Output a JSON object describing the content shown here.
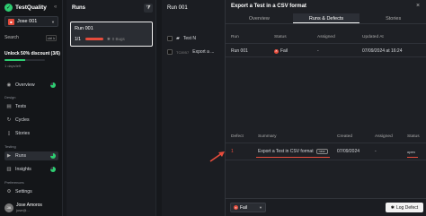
{
  "app": {
    "name": "TestQuality"
  },
  "sidebar": {
    "project": "Jose 001",
    "search_label": "Search",
    "search_shortcut": "ctrl k",
    "unlock": {
      "label": "Unlock 50% discount (3/6)",
      "progress": 0.5,
      "sub": "1 days/left"
    },
    "sections": {
      "design": "Design",
      "testing": "Testing",
      "preferences": "Preferences"
    },
    "items": [
      {
        "label": "Overview"
      },
      {
        "label": "Tests"
      },
      {
        "label": "Cycles"
      },
      {
        "label": "Stories"
      },
      {
        "label": "Runs"
      },
      {
        "label": "Insights"
      },
      {
        "label": "Settings"
      },
      {
        "label": "Integrations"
      }
    ],
    "user": {
      "initials": "JA",
      "name": "Jose Amoros",
      "email": "jose@..."
    }
  },
  "runs": {
    "title": "Runs",
    "card": {
      "name": "Run 001",
      "count": "1/1",
      "bugs": "0 Bugs"
    }
  },
  "run_detail": {
    "title": "Run 001",
    "rows": [
      {
        "label": "Test N"
      },
      {
        "id": "TC8957",
        "label": "Export a ..."
      }
    ]
  },
  "drawer": {
    "title": "Export a Test in a CSV format",
    "close": "×",
    "tabs": [
      "Overview",
      "Runs & Defects",
      "Stories"
    ],
    "runs_table": {
      "headers": [
        "Run",
        "Status",
        "Assigned",
        "Updated At"
      ],
      "rows": [
        {
          "run": "Run 001",
          "status": "Fail",
          "assigned": "-",
          "updated": "07/09/2024 at 16:24"
        }
      ]
    },
    "defects_table": {
      "headers": [
        "Defect",
        "Summary",
        "Created",
        "Assigned",
        "Status"
      ],
      "rows": [
        {
          "defect": "1",
          "summary": "Export a Test in CSV format",
          "badge": "new",
          "created": "07/09/2024",
          "assigned": "-",
          "status": "open"
        }
      ]
    },
    "footer": {
      "status": "Fail",
      "log_button": "Log Defect"
    }
  },
  "colors": {
    "accent": "#2ecc71",
    "fail": "#e74c3c"
  }
}
